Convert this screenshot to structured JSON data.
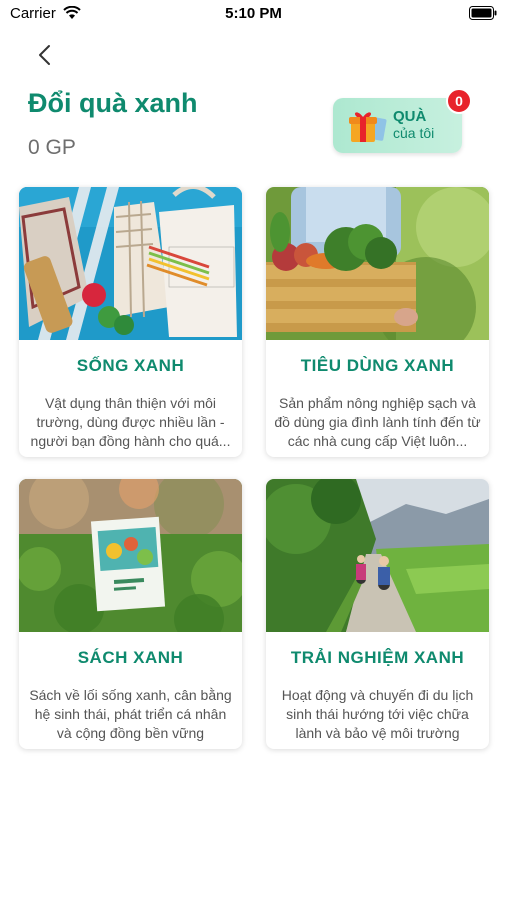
{
  "status_bar": {
    "carrier": "Carrier",
    "time": "5:10 PM"
  },
  "header": {
    "title": "Đổi quà xanh",
    "points": "0 GP"
  },
  "my_gifts": {
    "label_line1": "QUÀ",
    "label_line2": "của tôi",
    "badge_count": "0"
  },
  "categories": [
    {
      "title": "SỐNG XANH",
      "description": "Vật dụng thân thiện với môi trường, dùng được nhiều lần - người bạn đồng hành cho quá...",
      "image_icon": "eco-bags-and-bamboo-utensils-photo"
    },
    {
      "title": "TIÊU DÙNG XANH",
      "description": "Sản phẩm nông nghiệp sạch và đồ dùng gia đình lành tính đến từ các nhà cung cấp Việt luôn...",
      "image_icon": "vegetable-crate-photo"
    },
    {
      "title": "SÁCH XANH",
      "description": "Sách về lối sống xanh, cân bằng hệ sinh thái, phát triển cá nhân và cộng đồng bền vững",
      "image_icon": "book-on-grass-photo"
    },
    {
      "title": "TRẢI NGHIỆM XANH",
      "description": "Hoạt động và chuyến đi du lịch sinh thái hướng tới việc chữa lành và bảo vệ môi trường",
      "image_icon": "cycling-countryside-photo"
    }
  ],
  "colors": {
    "brand_green": "#0f8a6e",
    "badge_red": "#e8232b",
    "gift_button_bg": "#c7f0df"
  }
}
